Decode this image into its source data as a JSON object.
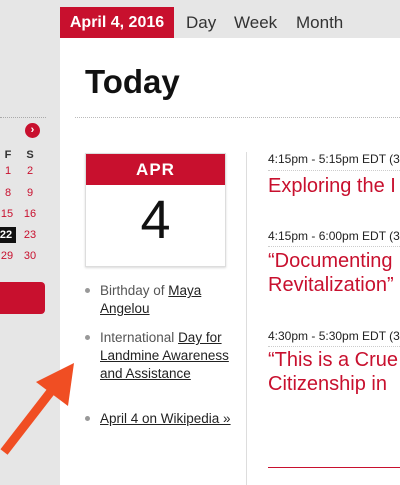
{
  "tabs": {
    "date": "April 4, 2016",
    "views": [
      "Day",
      "Week",
      "Month"
    ]
  },
  "sidebar": {
    "next_icon": "›",
    "weekday_headers": [
      "F",
      "S"
    ],
    "days": [
      [
        "1",
        "2"
      ],
      [
        "8",
        "9"
      ],
      [
        "15",
        "16"
      ],
      [
        "22",
        "23"
      ],
      [
        "29",
        "30"
      ]
    ],
    "highlighted_day": "22"
  },
  "main": {
    "title": "Today",
    "calendar_month": "APR",
    "calendar_day": "4",
    "facts": [
      {
        "prefix": "Birthday of ",
        "link": "Maya Angelou"
      },
      {
        "prefix": "International ",
        "link": "Day for Landmine Awareness and Assistance"
      },
      {
        "prefix": "",
        "link": "April 4 on Wikipedia »"
      }
    ]
  },
  "events": [
    {
      "time": "4:15pm - 5:15pm EDT (3",
      "title": [
        "Exploring the I"
      ]
    },
    {
      "time": "4:15pm - 6:00pm EDT (3",
      "title": [
        "“Documenting",
        "Revitalization”"
      ]
    },
    {
      "time": "4:30pm - 5:30pm EDT (3",
      "title": [
        "“This is a Crue",
        "Citizenship in"
      ]
    }
  ],
  "colors": {
    "accent": "#c8102e",
    "sidebar_bg": "#e6e6e6"
  }
}
